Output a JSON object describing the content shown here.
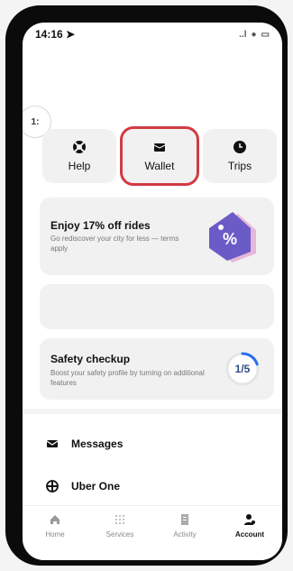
{
  "status_bar": {
    "time": "14:16 ➤",
    "signal": "..l",
    "wifi": "●",
    "battery": "▭"
  },
  "edge_control": {
    "label": "1:"
  },
  "tiles": [
    {
      "label": "Help",
      "icon": "lifebuoy-icon"
    },
    {
      "label": "Wallet",
      "icon": "wallet-icon",
      "highlighted": true,
      "highlight_color": "#d33a45"
    },
    {
      "label": "Trips",
      "icon": "clock-icon"
    }
  ],
  "promo": {
    "title": "Enjoy 17% off rides",
    "subtitle": "Go rediscover your city for less — terms apply",
    "badge": "%",
    "icon": "discount-tag-icon",
    "accent": "#6b5bc7"
  },
  "safety": {
    "title": "Safety checkup",
    "subtitle": "Boost your safety profile by turning on additional features",
    "progress_label": "1/5",
    "progress": 0.2,
    "accent": "#276ef1"
  },
  "menu": [
    {
      "label": "Messages",
      "icon": "envelope-icon"
    },
    {
      "label": "Uber One",
      "icon": "uber-one-icon"
    }
  ],
  "nav": [
    {
      "label": "Home",
      "icon": "home-icon",
      "active": false
    },
    {
      "label": "Services",
      "icon": "grid-icon",
      "active": false
    },
    {
      "label": "Activity",
      "icon": "receipt-icon",
      "active": false
    },
    {
      "label": "Account",
      "icon": "person-icon",
      "active": true
    }
  ]
}
